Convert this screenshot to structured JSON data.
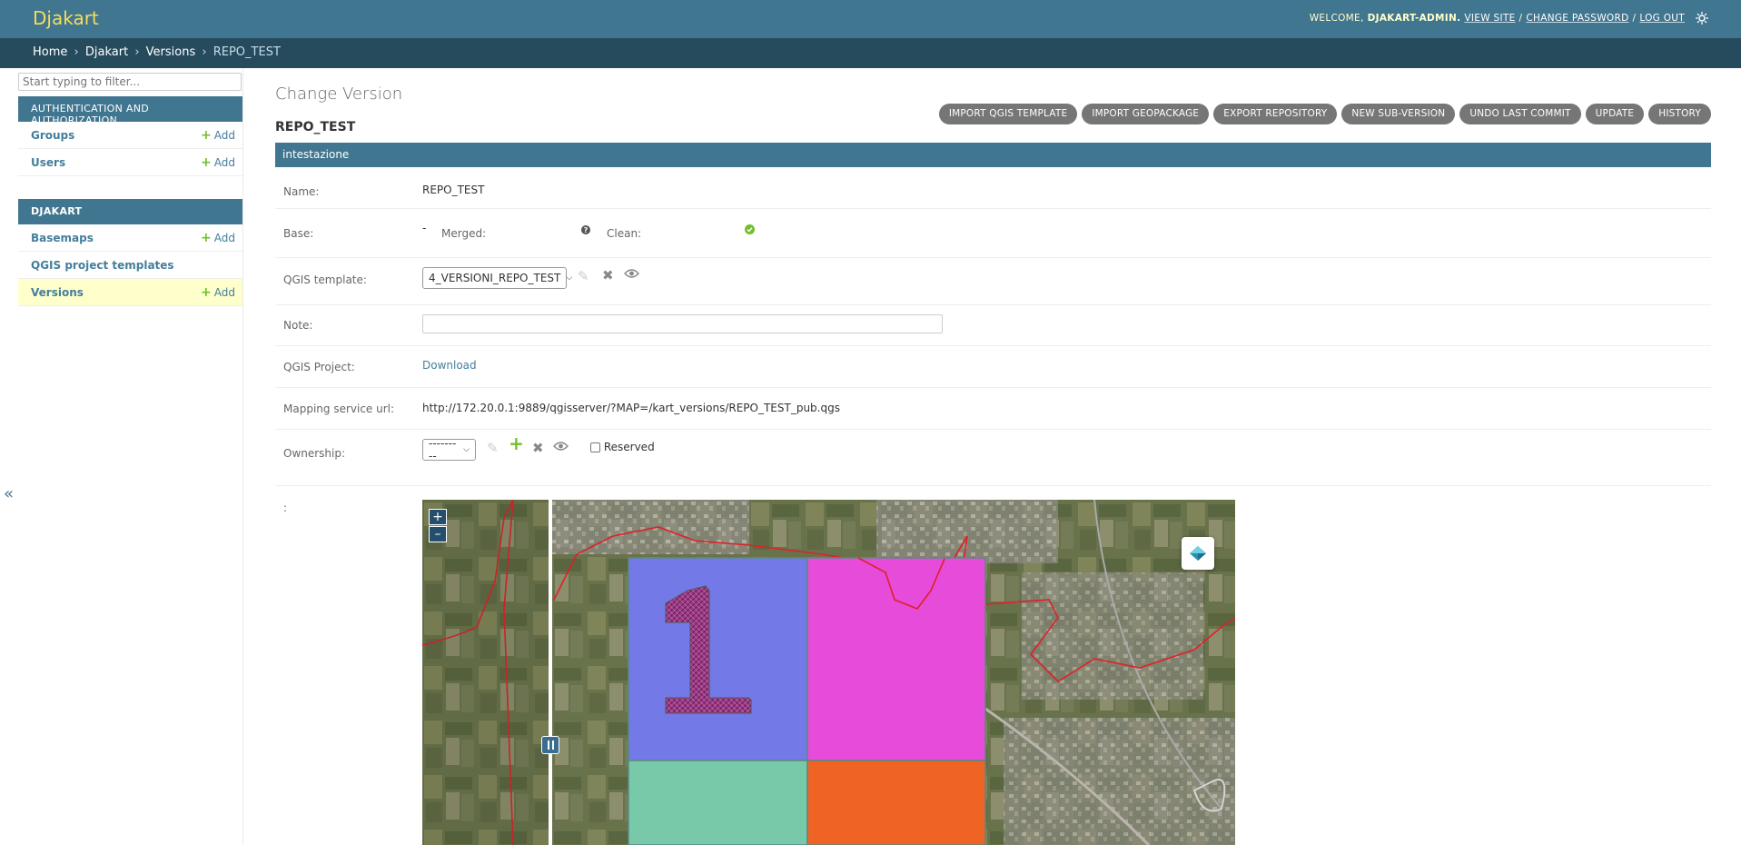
{
  "header": {
    "brand": "Djakart",
    "welcome": "WELCOME,",
    "username": "DJAKART-ADMIN.",
    "view_site": "VIEW SITE",
    "change_password": "CHANGE PASSWORD",
    "log_out": "LOG OUT",
    "separator": "/"
  },
  "breadcrumbs": {
    "home": "Home",
    "app": "Djakart",
    "model": "Versions",
    "current": "REPO_TEST",
    "arrow": "›"
  },
  "sidebar": {
    "filter_placeholder": "Start typing to filter...",
    "toggle": "«",
    "add_label": "Add",
    "apps": [
      {
        "caption": "AUTHENTICATION AND AUTHORIZATION",
        "models": [
          {
            "name": "Groups",
            "add": true
          },
          {
            "name": "Users",
            "add": true
          }
        ]
      },
      {
        "caption": "DJAKART",
        "models": [
          {
            "name": "Basemaps",
            "add": true
          },
          {
            "name": "QGIS project templates",
            "add": false
          },
          {
            "name": "Versions",
            "add": true
          }
        ]
      }
    ]
  },
  "main": {
    "page_title": "Change Version",
    "object_title": "REPO_TEST",
    "tools": [
      "IMPORT QGIS TEMPLATE",
      "IMPORT GEOPACKAGE",
      "EXPORT REPOSITORY",
      "NEW SUB-VERSION",
      "UNDO LAST COMMIT",
      "UPDATE",
      "HISTORY"
    ],
    "fieldset": "intestazione",
    "fields": {
      "name_label": "Name:",
      "name_value": "REPO_TEST",
      "base_label": "Base:",
      "base_value": "-",
      "merged_label": "Merged:",
      "clean_label": "Clean:",
      "qgis_template_label": "QGIS template:",
      "qgis_template_value": "4_VERSIONI_REPO_TEST",
      "note_label": "Note:",
      "note_value": "",
      "qgis_project_label": "QGIS Project:",
      "qgis_project_link": "Download",
      "mapping_label": "Mapping service url:",
      "mapping_value": "http://172.20.0.1:9889/qgisserver/?MAP=/kart_versions/REPO_TEST_pub.qgs",
      "ownership_label": "Ownership:",
      "ownership_value": "---------",
      "reserved_label": "Reserved",
      "map_label": ":"
    },
    "map": {
      "zoom_in": "+",
      "zoom_out": "–",
      "feature_label": "1",
      "colors": {
        "blue_square": "#7379e6",
        "magenta_square": "#e64bd9",
        "teal_square": "#78c9aa",
        "orange_square": "#ef6325",
        "boundary": "#e0202a"
      }
    }
  },
  "colors": {
    "header_bg": "#417690",
    "breadcrumb_bg": "#264b5d",
    "brand": "#f5dd5d",
    "link": "#447e9b",
    "add_plus": "#70bf2b",
    "current_row": "#ffffcc"
  }
}
